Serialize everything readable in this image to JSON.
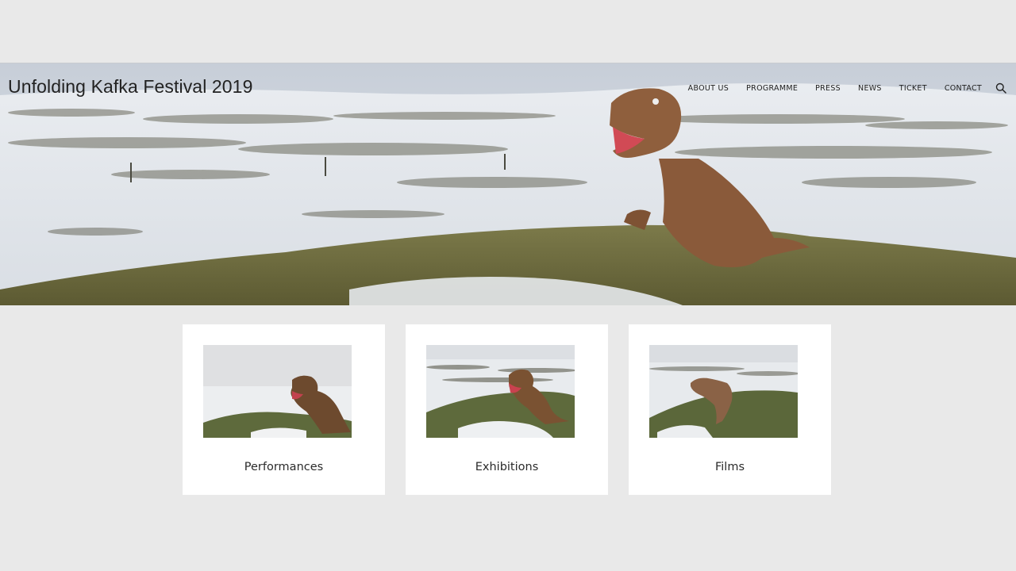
{
  "site": {
    "title": "Unfolding Kafka Festival 2019"
  },
  "nav": {
    "items": [
      {
        "label": "ABOUT US"
      },
      {
        "label": "PROGRAMME"
      },
      {
        "label": "PRESS"
      },
      {
        "label": "NEWS"
      },
      {
        "label": "TICKET"
      },
      {
        "label": "CONTACT"
      }
    ],
    "search_icon": "search-icon"
  },
  "cards": [
    {
      "label": "Performances"
    },
    {
      "label": "Exhibitions"
    },
    {
      "label": "Films"
    }
  ],
  "colors": {
    "page_bg": "#e9e9e9",
    "card_bg": "#ffffff",
    "text": "#222222"
  }
}
